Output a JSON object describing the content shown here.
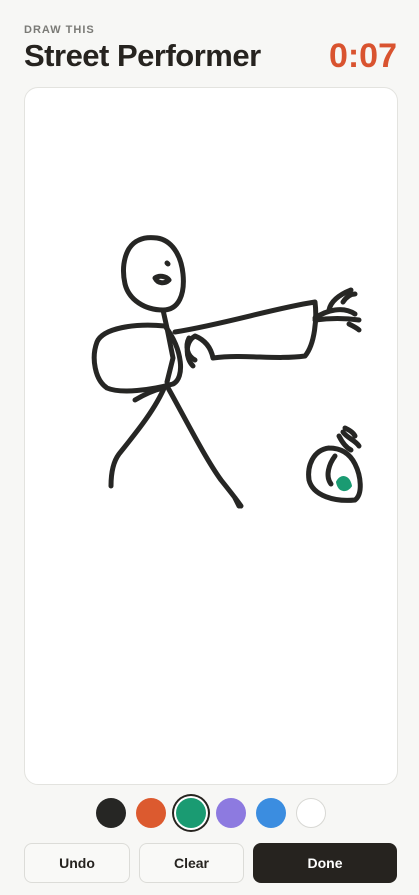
{
  "header": {
    "label": "DRAW THIS",
    "word": "Street Performer",
    "timer": "0:07"
  },
  "palette": {
    "colors": [
      {
        "name": "black",
        "hex": "#262624"
      },
      {
        "name": "orange",
        "hex": "#dc5a2f"
      },
      {
        "name": "green",
        "hex": "#1a9b72"
      },
      {
        "name": "purple",
        "hex": "#8d7ae0"
      },
      {
        "name": "blue",
        "hex": "#3b8de0"
      },
      {
        "name": "white",
        "hex": "#ffffff"
      }
    ],
    "selected": "green"
  },
  "actions": {
    "undo": "Undo",
    "clear": "Clear",
    "done": "Done"
  },
  "colors": {
    "accent": "#d9532f",
    "ink": "#26231f",
    "stroke_black": "#262624",
    "stroke_green": "#1a9b72"
  }
}
